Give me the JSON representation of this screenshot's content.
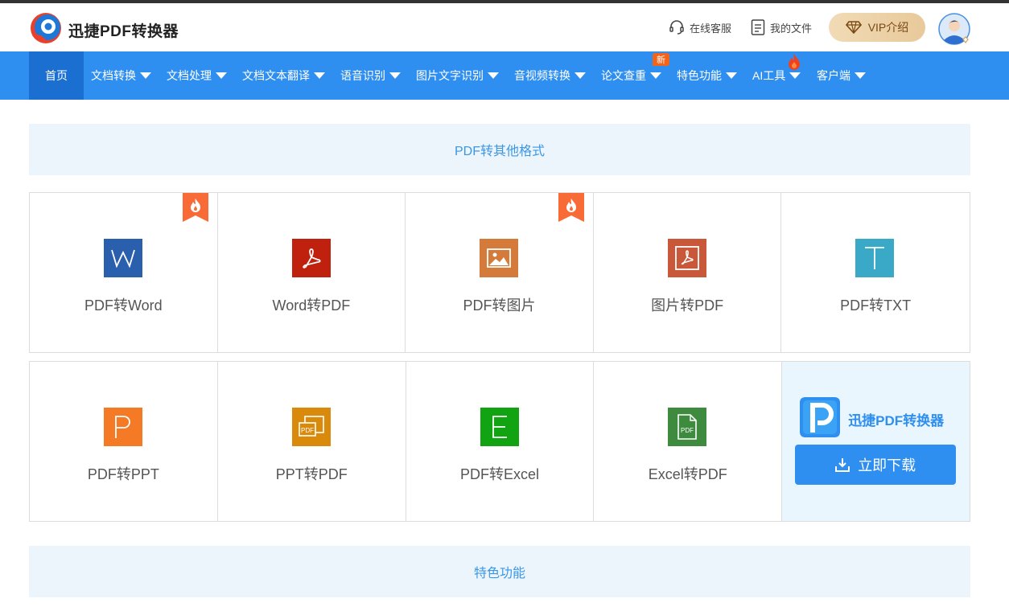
{
  "header": {
    "brand": "迅捷PDF转换器",
    "service_label": "在线客服",
    "files_label": "我的文件",
    "vip_label": "VIP介绍"
  },
  "nav": {
    "items": [
      {
        "label": "首页",
        "has_caret": false
      },
      {
        "label": "文档转换",
        "has_caret": true
      },
      {
        "label": "文档处理",
        "has_caret": true
      },
      {
        "label": "文档文本翻译",
        "has_caret": true
      },
      {
        "label": "语音识别",
        "has_caret": true
      },
      {
        "label": "图片文字识别",
        "has_caret": true
      },
      {
        "label": "音视频转换",
        "has_caret": true
      },
      {
        "label": "论文查重",
        "has_caret": true
      },
      {
        "label": "特色功能",
        "has_caret": true
      },
      {
        "label": "AI工具",
        "has_caret": true
      },
      {
        "label": "客户端",
        "has_caret": true
      }
    ],
    "badge_new": "新"
  },
  "sections": {
    "pdf_to_other": "PDF转其他格式",
    "features": "特色功能"
  },
  "tools_row1": [
    {
      "label": "PDF转Word",
      "icon": "word-icon",
      "color": "#2a5fad",
      "hot": true
    },
    {
      "label": "Word转PDF",
      "icon": "acrobat-icon",
      "color": "#c0210f",
      "hot": false
    },
    {
      "label": "PDF转图片",
      "icon": "image-icon",
      "color": "#d47a3a",
      "hot": true
    },
    {
      "label": "图片转PDF",
      "icon": "image-pdf-icon",
      "color": "#c9583a",
      "hot": false
    },
    {
      "label": "PDF转TXT",
      "icon": "txt-icon",
      "color": "#3aa9c8",
      "hot": false
    }
  ],
  "tools_row2": [
    {
      "label": "PDF转PPT",
      "icon": "ppt-icon",
      "color": "#f57a25"
    },
    {
      "label": "PPT转PDF",
      "icon": "ppt-pdf-icon",
      "color": "#d98a0b"
    },
    {
      "label": "PDF转Excel",
      "icon": "excel-icon",
      "color": "#12a312"
    },
    {
      "label": "Excel转PDF",
      "icon": "excel-pdf-icon",
      "color": "#3e8a3e"
    }
  ],
  "promo": {
    "name": "迅捷PDF转换器",
    "download_label": "立即下载"
  }
}
